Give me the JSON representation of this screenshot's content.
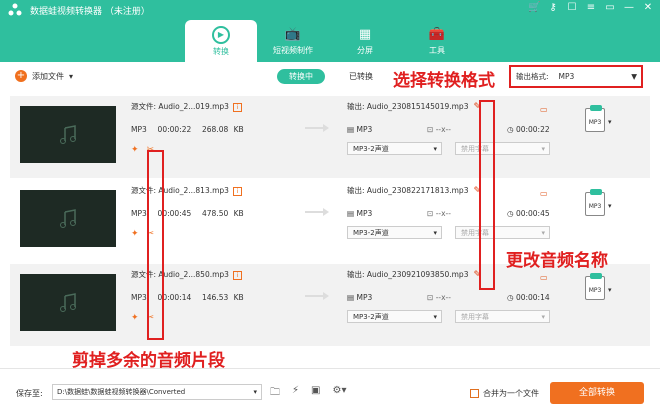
{
  "app": {
    "title": "数据蛙视频转换器 （未注册）"
  },
  "nav": {
    "tabs": [
      {
        "label": "转换",
        "icon": "convert-icon"
      },
      {
        "label": "短视频制作",
        "icon": "tv-icon"
      },
      {
        "label": "分屏",
        "icon": "split-screen-icon"
      },
      {
        "label": "工具",
        "icon": "toolbox-icon"
      }
    ]
  },
  "toolbar": {
    "add_file": "添加文件",
    "converting": "转换中",
    "converted": "已转换",
    "output_format_label": "输出格式:",
    "output_format_value": "MP3"
  },
  "annotations": {
    "choose_format": "选择转换格式",
    "rename_audio": "更改音频名称",
    "trim_audio": "剪掉多余的音频片段"
  },
  "files": [
    {
      "source_name": "源文件: Audio_2...019.mp3",
      "format": "MP3",
      "duration": "00:00:22",
      "size": "268.08 KB",
      "output_name": "输出: Audio_230815145019.mp3",
      "output_format": "MP3",
      "resolution": "--x--",
      "output_duration": "00:00:22",
      "audio_track": "MP3-2声道",
      "subtitle": "禁用字幕"
    },
    {
      "source_name": "源文件: Audio_2...813.mp3",
      "format": "MP3",
      "duration": "00:00:45",
      "size": "478.50 KB",
      "output_name": "输出: Audio_230822171813.mp3",
      "output_format": "MP3",
      "resolution": "--x--",
      "output_duration": "00:00:45",
      "audio_track": "MP3-2声道",
      "subtitle": "禁用字幕"
    },
    {
      "source_name": "源文件: Audio_2...850.mp3",
      "format": "MP3",
      "duration": "00:00:14",
      "size": "146.53 KB",
      "output_name": "输出: Audio_230921093850.mp3",
      "output_format": "MP3",
      "resolution": "--x--",
      "output_duration": "00:00:14",
      "audio_track": "MP3-2声道",
      "subtitle": "禁用字幕"
    }
  ],
  "output_format_icon": "MP3",
  "footer": {
    "save_label": "保存至:",
    "save_path": "D:\\数据蛙\\数据蛙视频转换器\\Converted",
    "merge_label": "合并为一个文件",
    "convert_all": "全部转换"
  },
  "colors": {
    "brand": "#2fbf9e",
    "accent": "#f07020",
    "annotation": "#e02020"
  }
}
